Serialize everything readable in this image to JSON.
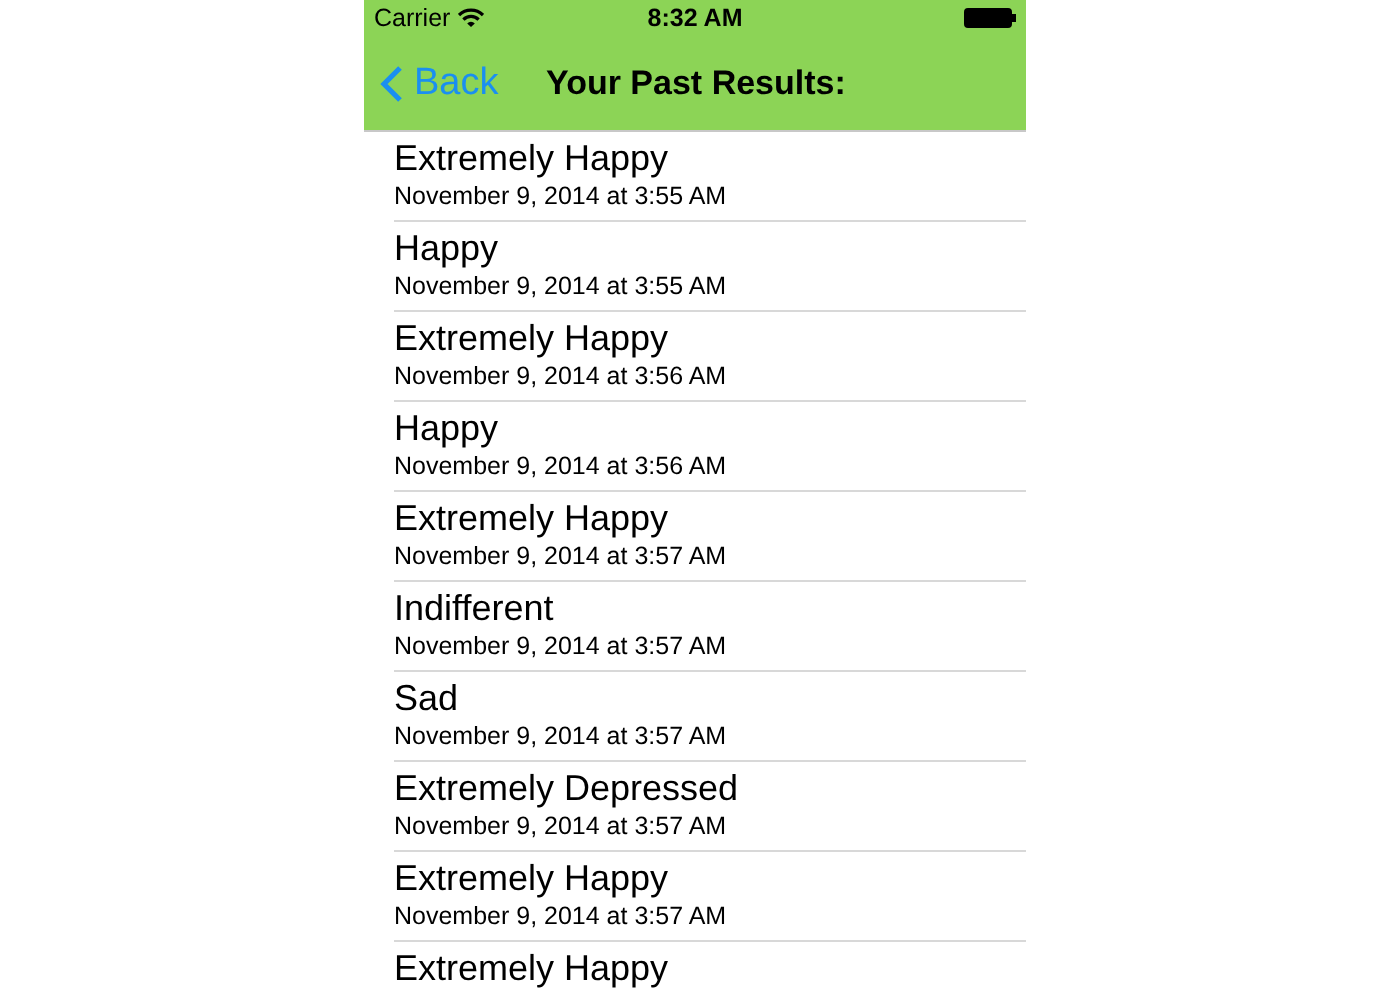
{
  "status_bar": {
    "carrier": "Carrier",
    "time": "8:32 AM"
  },
  "nav_bar": {
    "back": "Back",
    "title": "Your Past Results:"
  },
  "rows": [
    {
      "title": "Extremely Happy",
      "date": "November 9, 2014 at 3:55 AM"
    },
    {
      "title": "Happy",
      "date": "November 9, 2014 at 3:55 AM"
    },
    {
      "title": "Extremely Happy",
      "date": "November 9, 2014 at 3:56 AM"
    },
    {
      "title": "Happy",
      "date": "November 9, 2014 at 3:56 AM"
    },
    {
      "title": "Extremely Happy",
      "date": "November 9, 2014 at 3:57 AM"
    },
    {
      "title": "Indifferent",
      "date": "November 9, 2014 at 3:57 AM"
    },
    {
      "title": "Sad",
      "date": "November 9, 2014 at 3:57 AM"
    },
    {
      "title": "Extremely Depressed",
      "date": "November 9, 2014 at 3:57 AM"
    },
    {
      "title": "Extremely Happy",
      "date": "November 9, 2014 at 3:57 AM"
    },
    {
      "title": "Extremely Happy"
    }
  ]
}
